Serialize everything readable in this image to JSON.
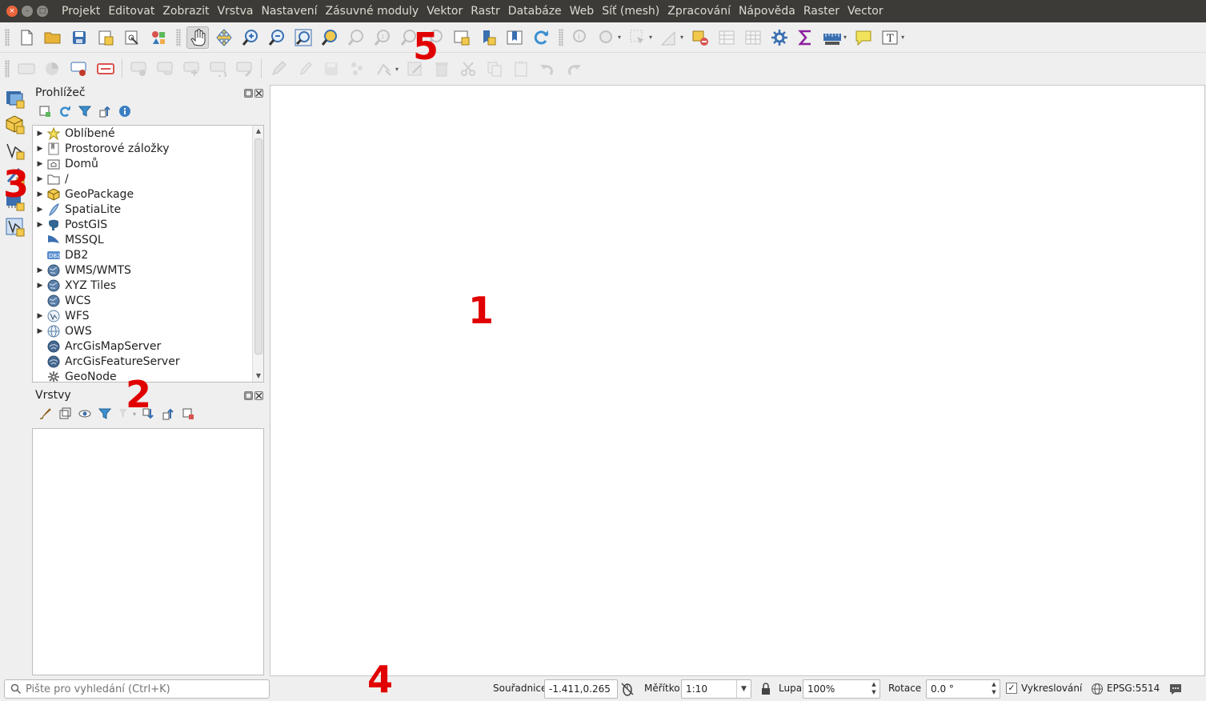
{
  "window": {
    "buttons": [
      "close",
      "minimize",
      "maximize"
    ],
    "close_glyph": "×",
    "minimize_glyph": "–",
    "maximize_glyph": "□"
  },
  "menu": [
    "Projekt",
    "Editovat",
    "Zobrazit",
    "Vrstva",
    "Nastavení",
    "Zásuvné moduly",
    "Vektor",
    "Rastr",
    "Databáze",
    "Web",
    "Síť (mesh)",
    "Zpracování",
    "Nápověda",
    "Raster",
    "Vector"
  ],
  "browser_panel": {
    "title": "Prohlížeč",
    "items": [
      {
        "label": "Oblíbené",
        "expandable": true,
        "icon": "star-icon"
      },
      {
        "label": "Prostorové záložky",
        "expandable": true,
        "icon": "bookmark-icon"
      },
      {
        "label": "Domů",
        "expandable": true,
        "icon": "home-folder-icon"
      },
      {
        "label": "/",
        "expandable": true,
        "icon": "folder-icon"
      },
      {
        "label": "GeoPackage",
        "expandable": true,
        "icon": "geopackage-icon"
      },
      {
        "label": "SpatiaLite",
        "expandable": true,
        "icon": "spatialite-icon"
      },
      {
        "label": "PostGIS",
        "expandable": true,
        "icon": "postgis-icon"
      },
      {
        "label": "MSSQL",
        "expandable": false,
        "icon": "mssql-icon"
      },
      {
        "label": "DB2",
        "expandable": false,
        "icon": "db2-icon"
      },
      {
        "label": "WMS/WMTS",
        "expandable": true,
        "icon": "globe-icon"
      },
      {
        "label": "XYZ Tiles",
        "expandable": true,
        "icon": "globe-icon"
      },
      {
        "label": "WCS",
        "expandable": false,
        "icon": "globe-icon"
      },
      {
        "label": "WFS",
        "expandable": true,
        "icon": "wfs-globe-icon"
      },
      {
        "label": "OWS",
        "expandable": true,
        "icon": "ows-globe-icon"
      },
      {
        "label": "ArcGisMapServer",
        "expandable": false,
        "icon": "arcgis-icon"
      },
      {
        "label": "ArcGisFeatureServer",
        "expandable": false,
        "icon": "arcgis-icon"
      },
      {
        "label": "GeoNode",
        "expandable": false,
        "icon": "geonode-icon"
      }
    ],
    "db2_badge": "DB2"
  },
  "layers_panel": {
    "title": "Vrstvy"
  },
  "arrows": {
    "expand": "▶",
    "up": "▲",
    "down": "▼",
    "dropdown": "▾"
  },
  "status": {
    "search_placeholder": "Pište pro vyhledání (Ctrl+K)",
    "coord_label": "Souřadnice",
    "coord_value": "-1.411,0.265",
    "scale_label": "Měřítko",
    "scale_value": "1:10",
    "magnifier_label": "Lupa",
    "magnifier_value": "100%",
    "rotation_label": "Rotace",
    "rotation_value": "0.0 °",
    "render_label": "Vykreslování",
    "render_check": "✓",
    "crs": "EPSG:5514"
  },
  "annotations": {
    "map": "1",
    "layers": "2",
    "left_toolbar": "3",
    "status": "4",
    "toolbar": "5"
  },
  "colors": {
    "accent": "#e10000",
    "titlebar": "#3c3b37",
    "close": "#e9633b"
  }
}
